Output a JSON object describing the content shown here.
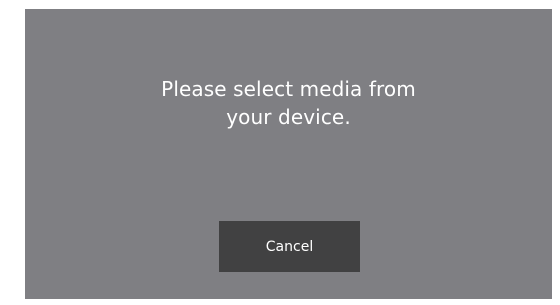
{
  "dialog": {
    "message_line1": "Please select media from",
    "message_line2": "your device.",
    "cancel_label": "Cancel"
  },
  "colors": {
    "dialog_background": "#7f7f83",
    "button_background": "#414142",
    "text": "#ffffff"
  }
}
